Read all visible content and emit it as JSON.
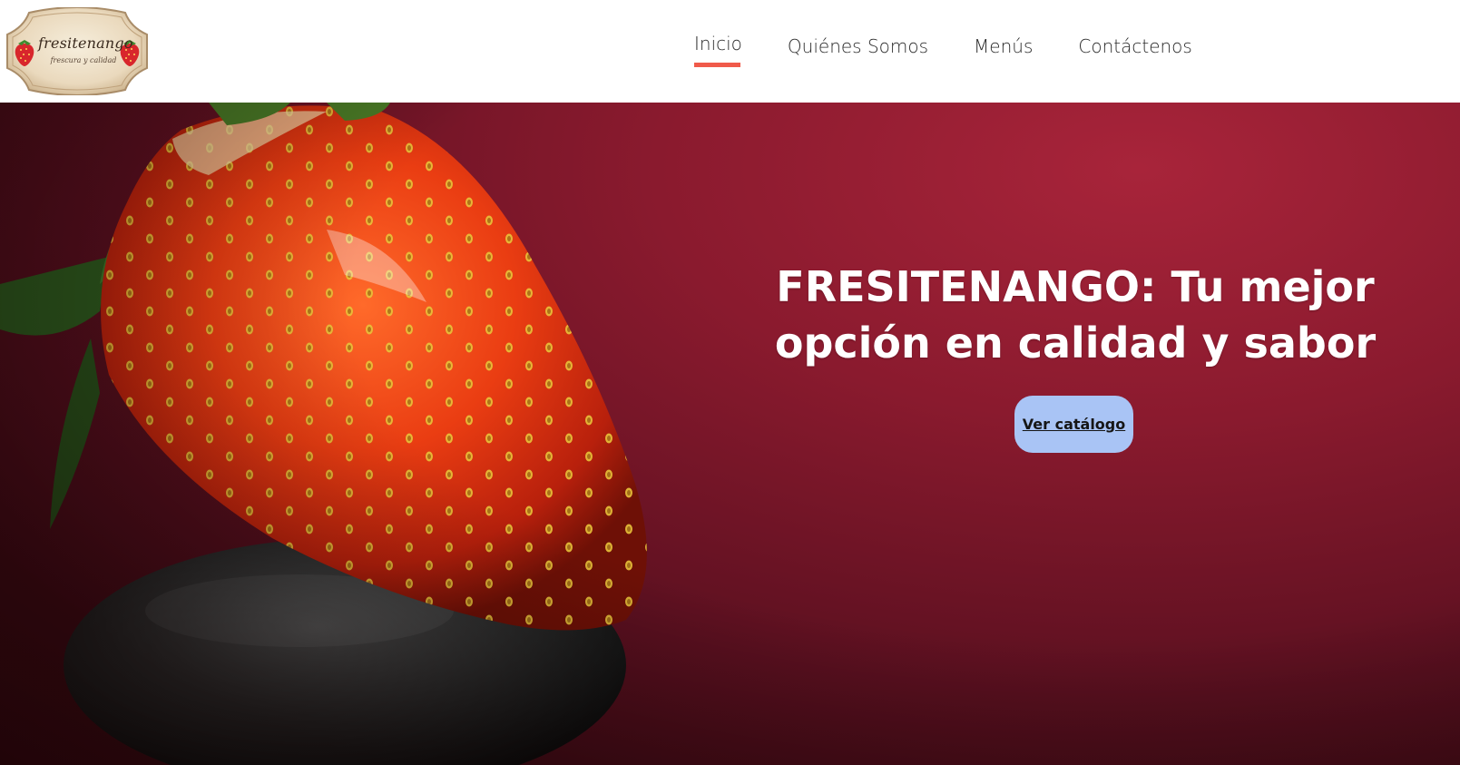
{
  "brand": {
    "name": "fresitenango",
    "tagline": "frescura y calidad"
  },
  "nav": {
    "items": [
      {
        "label": "Inicio",
        "active": true
      },
      {
        "label": "Quiénes Somos",
        "active": false
      },
      {
        "label": "Menús",
        "active": false
      },
      {
        "label": "Contáctenos",
        "active": false
      }
    ]
  },
  "hero": {
    "title": "FRESITENANGO: Tu mejor opción en calidad y sabor",
    "button_label": "Ver catálogo"
  },
  "colors": {
    "accent": "#f05a4a",
    "button_bg": "#a9c4f5",
    "hero_bg": "#8a1a2e"
  },
  "icons": [
    "strawberry-icon"
  ]
}
